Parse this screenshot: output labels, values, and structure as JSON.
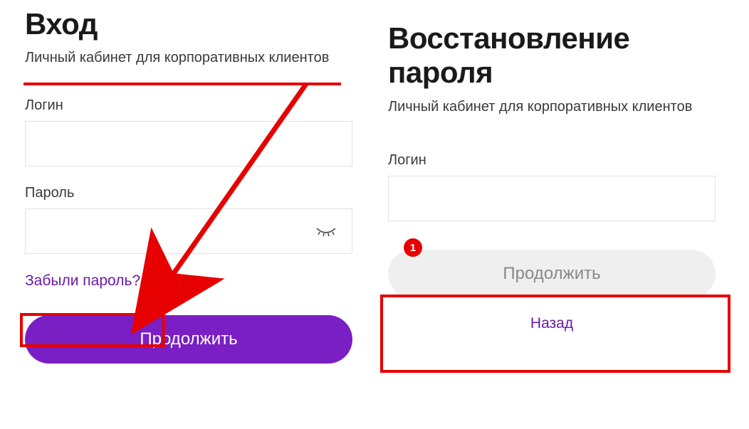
{
  "colors": {
    "purple": "#7a1fc4",
    "red": "#e60000"
  },
  "left": {
    "title": "Вход",
    "subtitle": "Личный кабинет для корпоративных клиентов",
    "login_label": "Логин",
    "login_value": "",
    "password_label": "Пароль",
    "password_value": "",
    "forgot": "Забыли пароль?",
    "submit": "Продолжить"
  },
  "right": {
    "title": "Восстановление пароля",
    "subtitle": "Личный кабинет для корпоративных клиентов",
    "login_label": "Логин",
    "login_value": "",
    "submit": "Продолжить",
    "back": "Назад"
  },
  "annotations": {
    "badge1": "1"
  }
}
